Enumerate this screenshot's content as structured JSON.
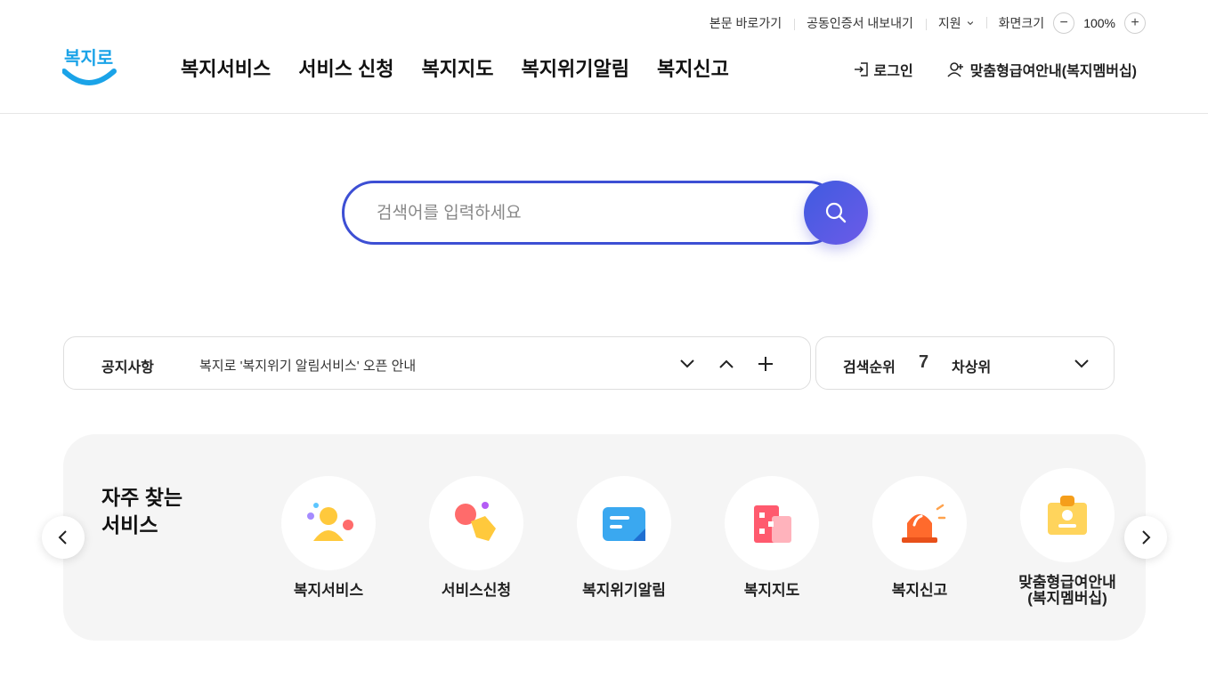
{
  "utility": {
    "skip_to_content": "본문 바로가기",
    "export_cert": "공동인증서 내보내기",
    "support": "지원",
    "screen_size_label": "화면크기",
    "zoom_minus": "−",
    "zoom_value": "100%",
    "zoom_plus": "+"
  },
  "brand": {
    "logo_text": "복지로",
    "logo_color": "#1aa3e8"
  },
  "gnb": {
    "items": [
      {
        "label": "복지서비스"
      },
      {
        "label": "서비스 신청"
      },
      {
        "label": "복지지도"
      },
      {
        "label": "복지위기알림"
      },
      {
        "label": "복지신고"
      }
    ]
  },
  "header_right": {
    "login": "로그인",
    "membership": "맞춤형급여안내(복지멤버십)"
  },
  "search": {
    "placeholder": "검색어를 입력하세요",
    "accent": "#3d4fd4"
  },
  "notice": {
    "title": "공지사항",
    "text": "복지로 '복지위기 알림서비스' 오픈 안내"
  },
  "ranking": {
    "title": "검색순위",
    "rank": "7",
    "keyword": "차상위"
  },
  "frequent": {
    "heading": "자주 찾는\n서비스",
    "items": [
      {
        "label": "복지서비스",
        "icon": "person-service-icon"
      },
      {
        "label": "서비스신청",
        "icon": "hand-apply-icon"
      },
      {
        "label": "복지위기알림",
        "icon": "message-alert-icon"
      },
      {
        "label": "복지지도",
        "icon": "building-map-icon"
      },
      {
        "label": "복지신고",
        "icon": "siren-icon"
      },
      {
        "label": "맞춤형급여안내\n(복지멤버십)",
        "icon": "membership-card-icon"
      }
    ]
  }
}
